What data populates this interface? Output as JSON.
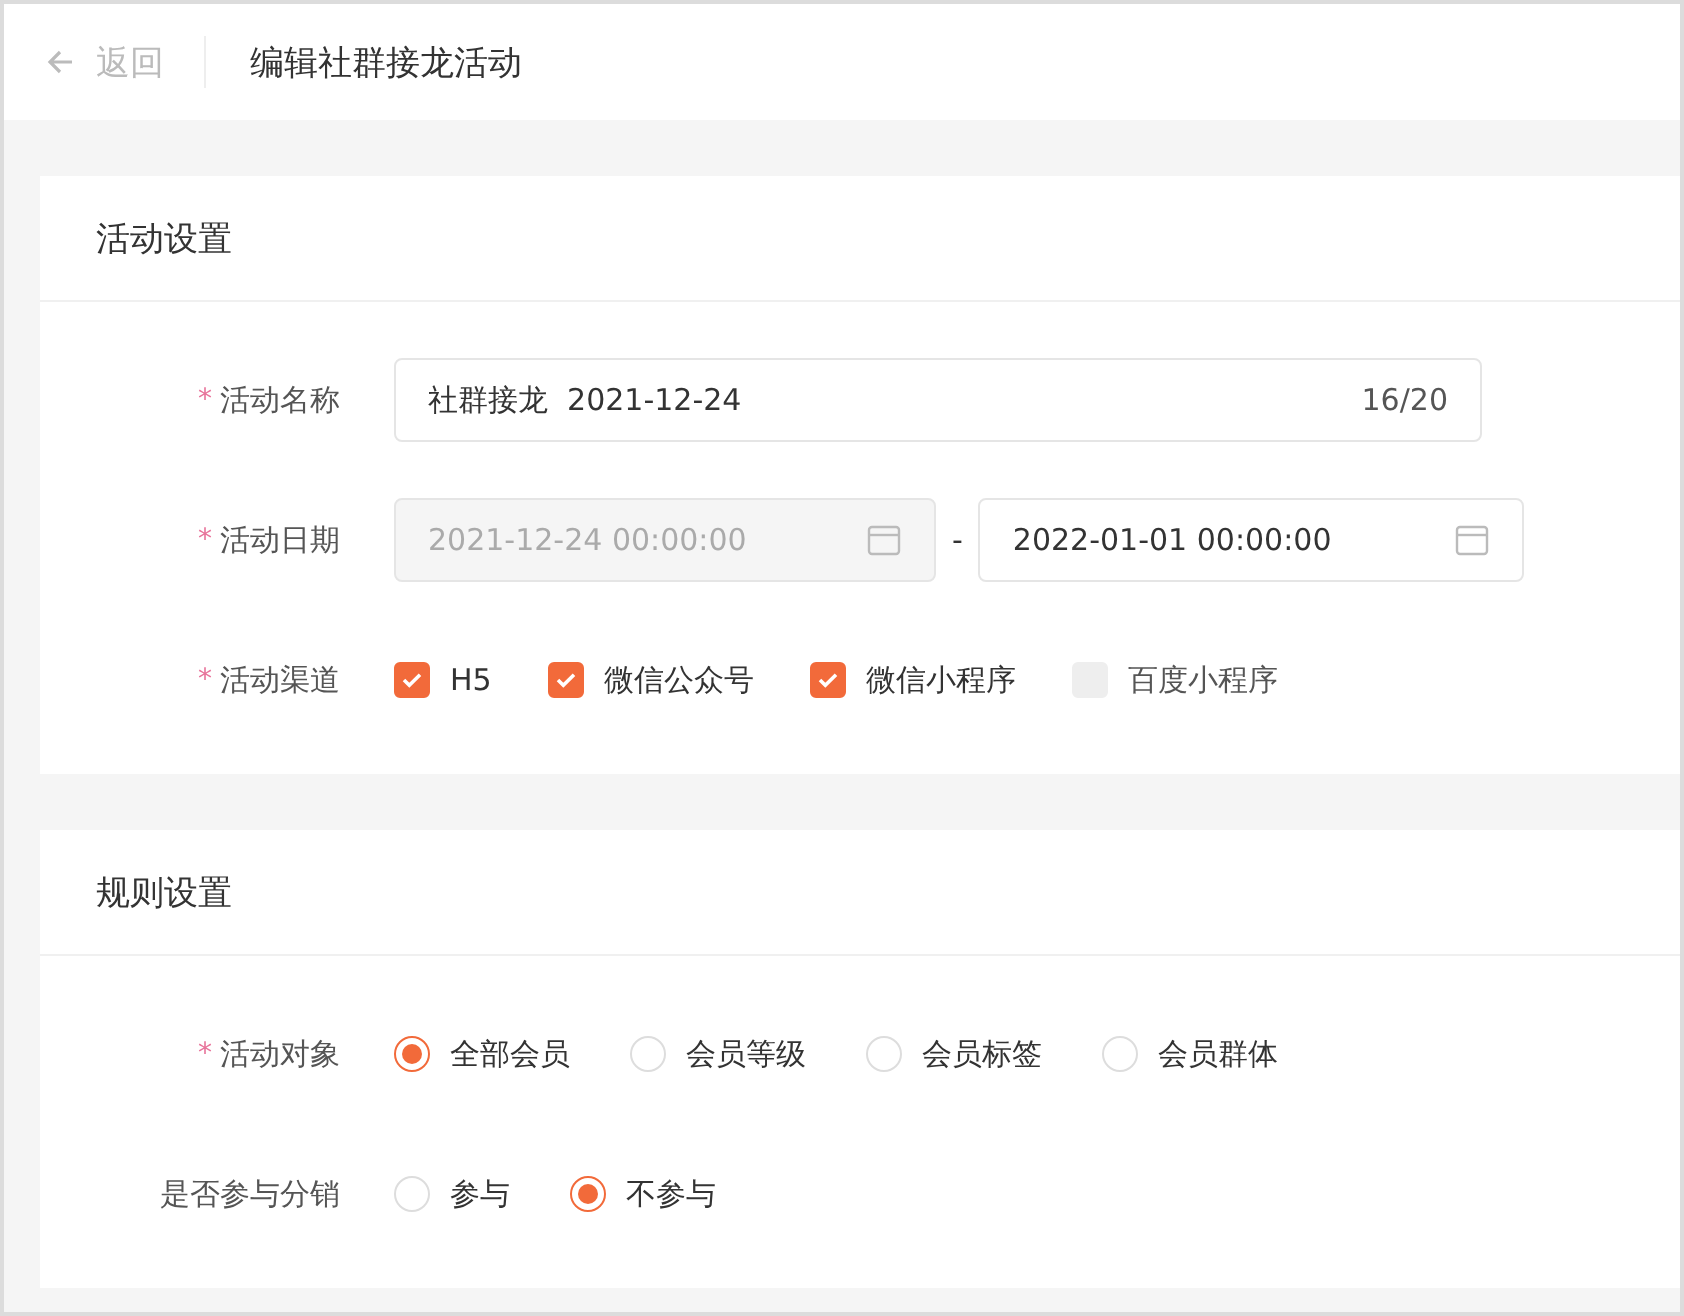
{
  "header": {
    "back_label": "返回",
    "title": "编辑社群接龙活动"
  },
  "sections": [
    {
      "title": "活动设置",
      "fields": [
        {
          "kind": "text",
          "label": "活动名称",
          "required_mark": "*",
          "value": "社群接龙  2021-12-24",
          "counter": "16/20"
        },
        {
          "kind": "date_range",
          "label": "活动日期",
          "required_mark": "*",
          "start": {
            "value": "2021-12-24 00:00:00",
            "disabled": true
          },
          "separator": "-",
          "end": {
            "value": "2022-01-01 00:00:00",
            "disabled": false
          }
        },
        {
          "kind": "checkboxes",
          "label": "活动渠道",
          "required_mark": "*",
          "options": [
            {
              "label": "H5",
              "checked": true,
              "disabled": false
            },
            {
              "label": "微信公众号",
              "checked": true,
              "disabled": false
            },
            {
              "label": "微信小程序",
              "checked": true,
              "disabled": false
            },
            {
              "label": "百度小程序",
              "checked": false,
              "disabled": true
            }
          ]
        }
      ]
    },
    {
      "title": "规则设置",
      "fields": [
        {
          "kind": "radios",
          "label": "活动对象",
          "required_mark": "*",
          "options": [
            {
              "label": "全部会员",
              "selected": true
            },
            {
              "label": "会员等级",
              "selected": false
            },
            {
              "label": "会员标签",
              "selected": false
            },
            {
              "label": "会员群体",
              "selected": false
            }
          ]
        },
        {
          "kind": "radios",
          "label": "是否参与分销",
          "options": [
            {
              "label": "参与",
              "selected": false
            },
            {
              "label": "不参与",
              "selected": true
            }
          ]
        }
      ]
    }
  ]
}
